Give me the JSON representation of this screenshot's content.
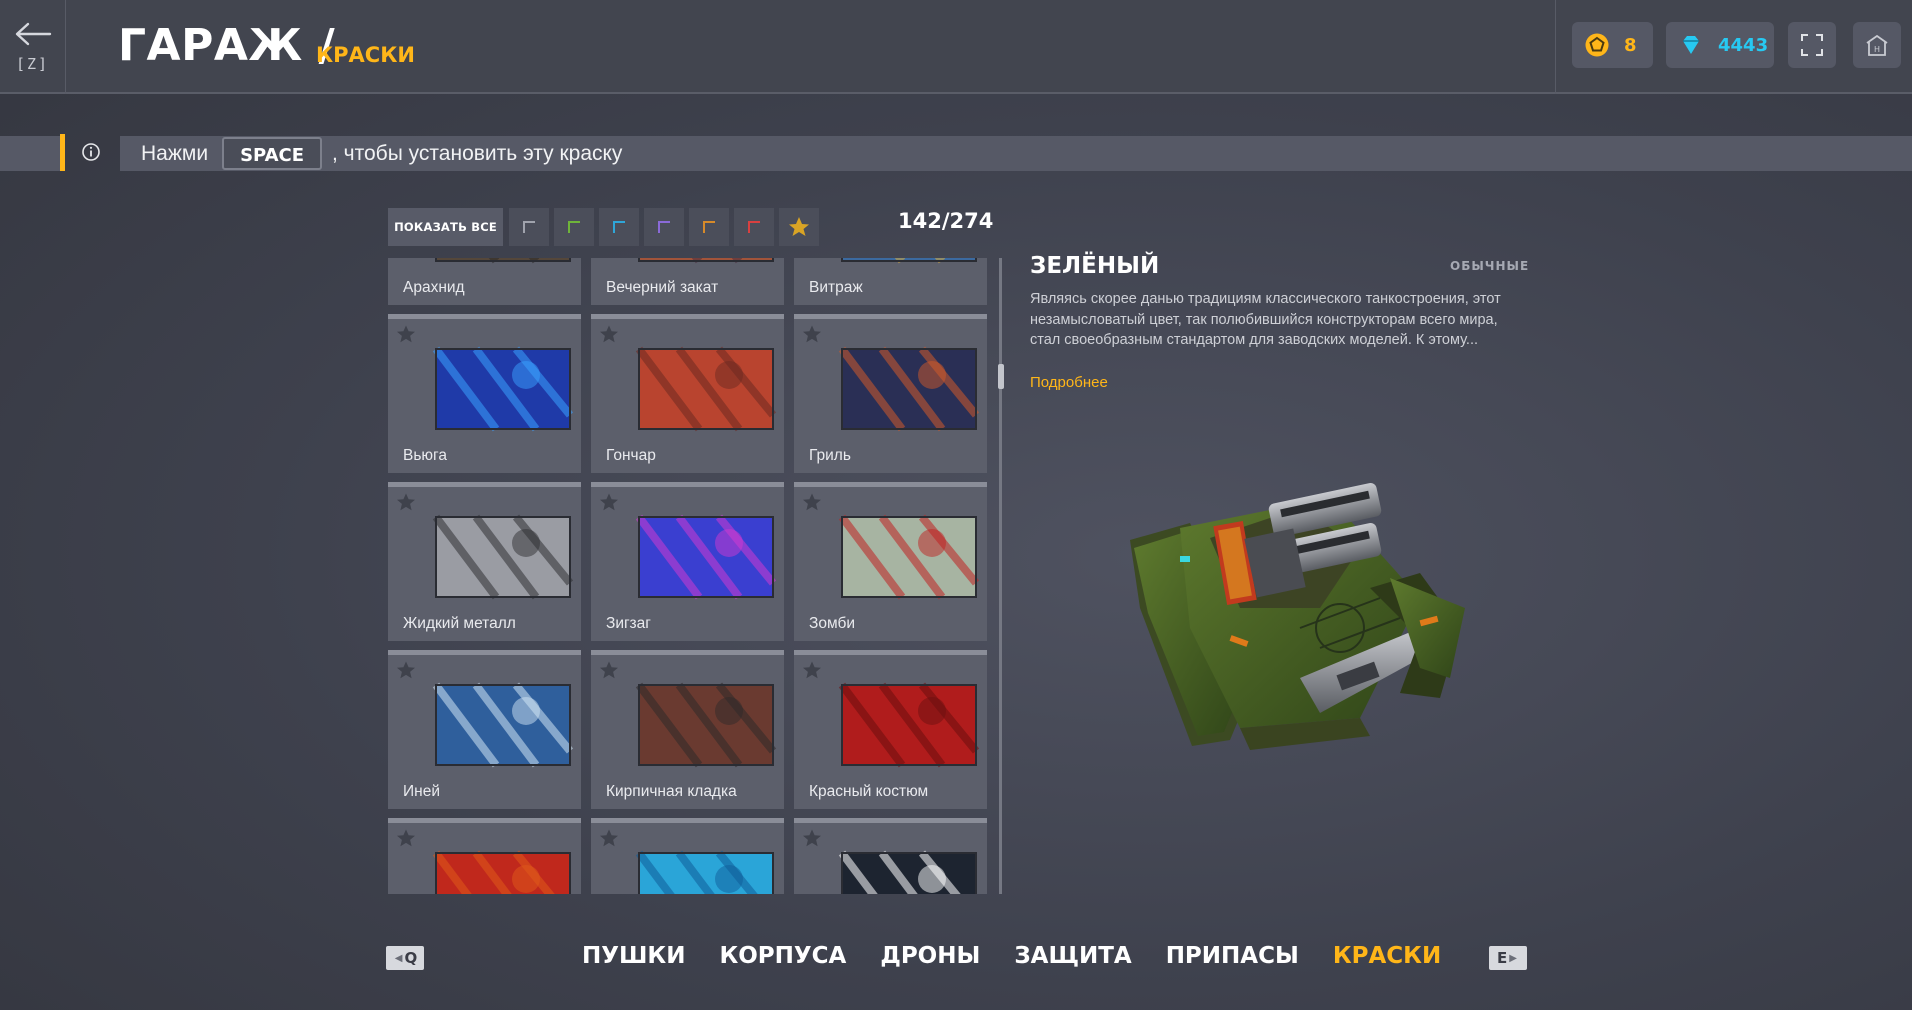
{
  "header": {
    "back_key": "[Z]",
    "title": "ГАРАЖ /",
    "subtitle": "КРАСКИ",
    "crystal_coins": "8",
    "crystals": "4443"
  },
  "hint": {
    "pre": "Нажми",
    "key": "SPACE",
    "post": ", чтобы установить эту краску"
  },
  "filters": {
    "show_all": "ПОКАЗАТЬ ВСЕ",
    "colors": [
      "#a0a3ad",
      "#6fb43a",
      "#2fa6d8",
      "#8a6ad8",
      "#d68a2a",
      "#d84040"
    ],
    "favorite_color": "#d9a425",
    "count": "142/274"
  },
  "grid": {
    "rows": [
      [
        {
          "name": "Арахнид",
          "bg": "#55473a",
          "accent": "#2d2a28"
        },
        {
          "name": "Вечерний закат",
          "bg": "#a2543a",
          "accent": "#4a2d3e"
        },
        {
          "name": "Витраж",
          "bg": "#3b6aa0",
          "accent": "#d6a83a"
        }
      ],
      [
        {
          "name": "Вьюга",
          "bg": "#1f3aa8",
          "accent": "#3aa0ff"
        },
        {
          "name": "Гончар",
          "bg": "#b9442f",
          "accent": "#6e2a22"
        },
        {
          "name": "Гриль",
          "bg": "#2a2f55",
          "accent": "#d05a2a"
        }
      ],
      [
        {
          "name": "Жидкий металл",
          "bg": "#9a9ca3",
          "accent": "#2f3034"
        },
        {
          "name": "Зигзаг",
          "bg": "#3a3fd0",
          "accent": "#d03ad0"
        },
        {
          "name": "Зомби",
          "bg": "#a7b4a2",
          "accent": "#c02222"
        }
      ],
      [
        {
          "name": "Иней",
          "bg": "#2f5f9c",
          "accent": "#cfe4f4"
        },
        {
          "name": "Кирпичная кладка",
          "bg": "#6a3a30",
          "accent": "#2f2a2a"
        },
        {
          "name": "Красный костюм",
          "bg": "#b01c1c",
          "accent": "#6c0f0f"
        }
      ],
      [
        {
          "name": "",
          "bg": "#c0281c",
          "accent": "#e05a1a"
        },
        {
          "name": "",
          "bg": "#2aa5d8",
          "accent": "#0f5d9a"
        },
        {
          "name": "",
          "bg": "#1d2430",
          "accent": "#ffffff"
        }
      ]
    ]
  },
  "detail": {
    "title": "ЗЕЛЁНЫЙ",
    "rarity": "ОБЫЧНЫЕ",
    "description": "Являясь скорее данью традициям классического танкостроения, этот незамысловатый цвет, так полюбившийся конструкторам всего мира, стал своеобразным стандартом для заводских моделей. К этому...",
    "more": "Подробнее"
  },
  "nav": {
    "prev_key": "Q",
    "next_key": "E",
    "tabs": [
      "ПУШКИ",
      "КОРПУСА",
      "ДРОНЫ",
      "ЗАЩИТА",
      "ПРИПАСЫ",
      "КРАСКИ"
    ],
    "active_tab": 5
  },
  "colors": {
    "accent": "#ffb619",
    "crystals": "#27c9f2"
  }
}
